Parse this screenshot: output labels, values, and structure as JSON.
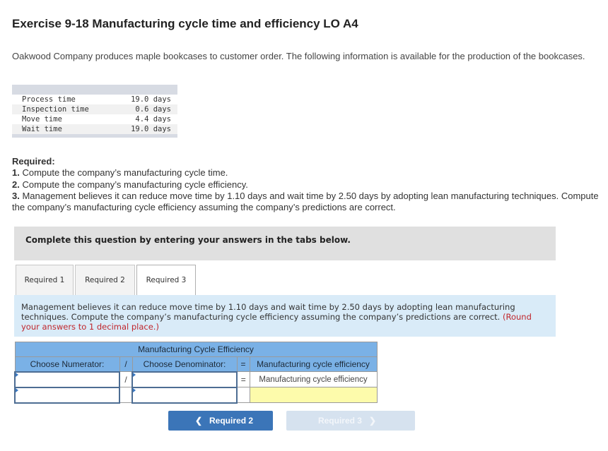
{
  "title": "Exercise 9-18 Manufacturing cycle time and efficiency LO A4",
  "intro": "Oakwood Company produces maple bookcases to customer order. The following information is available for the production of the bookcases.",
  "data_table": {
    "rows": [
      {
        "label": "Process time",
        "value": "19.0 days"
      },
      {
        "label": "Inspection time",
        "value": "0.6 days"
      },
      {
        "label": "Move time",
        "value": "4.4 days"
      },
      {
        "label": "Wait time",
        "value": "19.0 days"
      }
    ]
  },
  "required": {
    "heading": "Required:",
    "items": [
      {
        "num": "1.",
        "text": " Compute the company’s manufacturing cycle time."
      },
      {
        "num": "2.",
        "text": " Compute the company’s manufacturing cycle efficiency."
      },
      {
        "num": "3.",
        "text": " Management believes it can reduce move time by 1.10 days and wait time by 2.50 days by adopting lean manufacturing techniques. Compute the company’s manufacturing cycle efficiency assuming the company’s predictions are correct."
      }
    ]
  },
  "instruction": "Complete this question by entering your answers in the tabs below.",
  "tabs": [
    {
      "label": "Required 1",
      "active": false
    },
    {
      "label": "Required 2",
      "active": false
    },
    {
      "label": "Required 3",
      "active": true
    }
  ],
  "prompt": {
    "text": "Management believes it can reduce move time by 1.10 days and wait time by 2.50 days by adopting lean manufacturing techniques. Compute the company’s manufacturing cycle efficiency assuming the company’s predictions are correct. ",
    "round_note": "(Round your answers to 1 decimal place.)"
  },
  "mce_table": {
    "caption": "Manufacturing Cycle Efficiency",
    "headers": {
      "numerator": "Choose Numerator:",
      "divide": "/",
      "denominator": "Choose Denominator:",
      "equals": "=",
      "result": "Manufacturing cycle efficiency"
    },
    "row1": {
      "numerator": "",
      "divide": "/",
      "denominator": "",
      "equals": "=",
      "result_label": "Manufacturing cycle efficiency"
    },
    "row2": {
      "numerator": "",
      "denominator": "",
      "answer": ""
    }
  },
  "nav": {
    "prev_label": "Required 2",
    "prev_icon": "chevron-left-icon",
    "next_label": "Required 3",
    "next_icon": "chevron-right-icon",
    "prev_color": "#3b75b8",
    "next_color": "#d6e2ef"
  }
}
